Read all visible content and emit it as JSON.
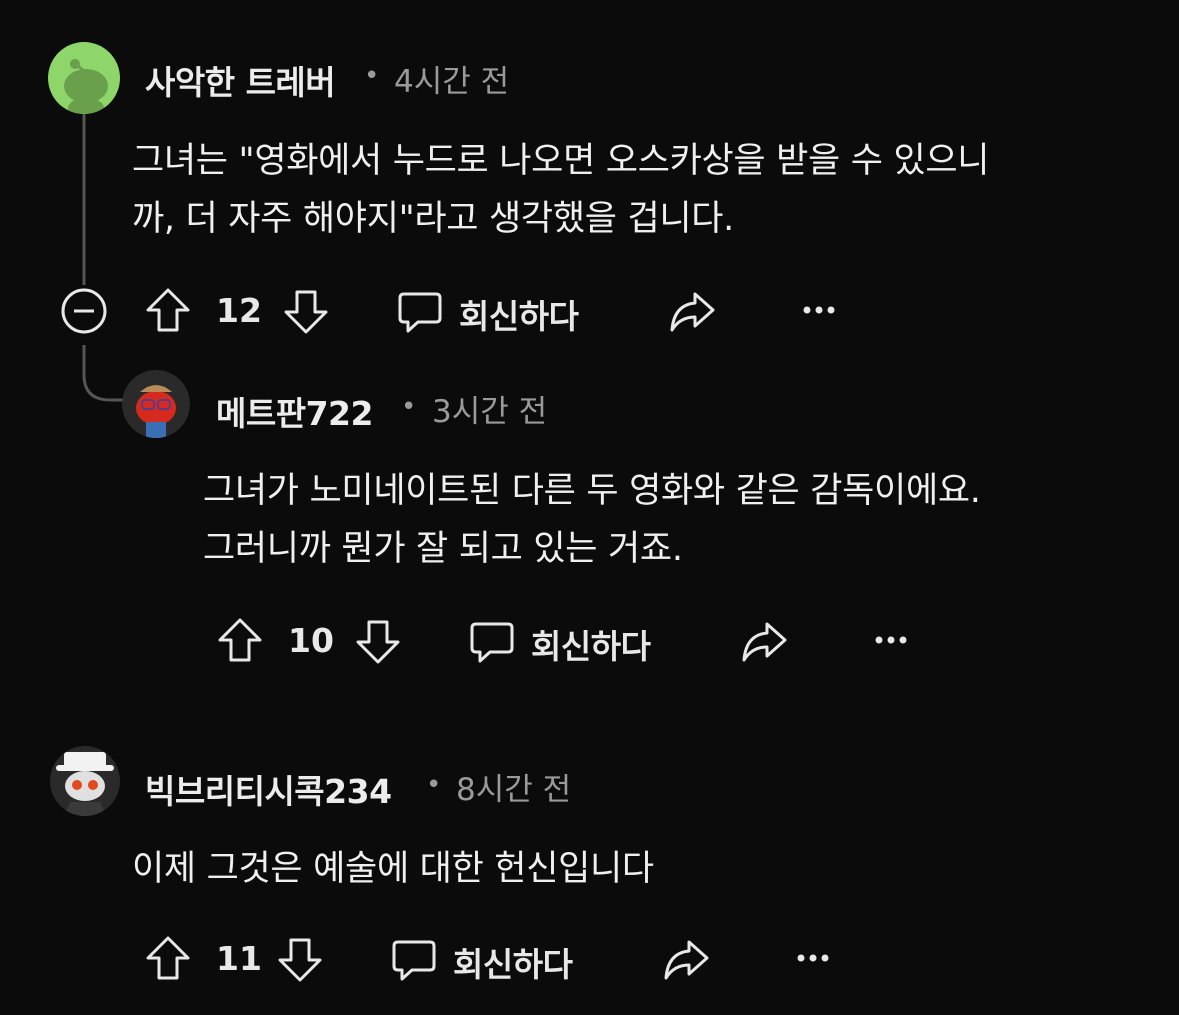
{
  "comments": [
    {
      "username": "사악한 트레버",
      "separator": "•",
      "time": "4시간 전",
      "lines": [
        "그녀는 \"영화에서 누드로 나오면 오스카상을 받을 수 있으니",
        "까, 더 자주 해야지\"라고 생각했을 겁니다."
      ],
      "votes": "12",
      "reply_label": "회신하다",
      "avatar_color": "#8fd66a"
    },
    {
      "username": "메트판722",
      "separator": "•",
      "time": "3시간 전",
      "lines": [
        "그녀가 노미네이트된 다른 두 영화와 같은 감독이에요.",
        "그러니까 뭔가 잘 되고 있는 거죠."
      ],
      "votes": "10",
      "reply_label": "회신하다",
      "avatar_color": "#d62a1e"
    },
    {
      "username": "빅브리티시콕234",
      "separator": "•",
      "time": "8시간 전",
      "lines": [
        "이제 그것은 예술에 대한 헌신입니다"
      ],
      "votes": "11",
      "reply_label": "회신하다",
      "avatar_color": "#e8e8e8"
    }
  ],
  "colors": {
    "background": "#0b0b0b",
    "thread_line": "#555555",
    "muted": "#9a9a9a"
  },
  "icons": [
    "collapse-icon",
    "upvote-icon",
    "downvote-icon",
    "comment-icon",
    "share-icon",
    "more-icon"
  ]
}
